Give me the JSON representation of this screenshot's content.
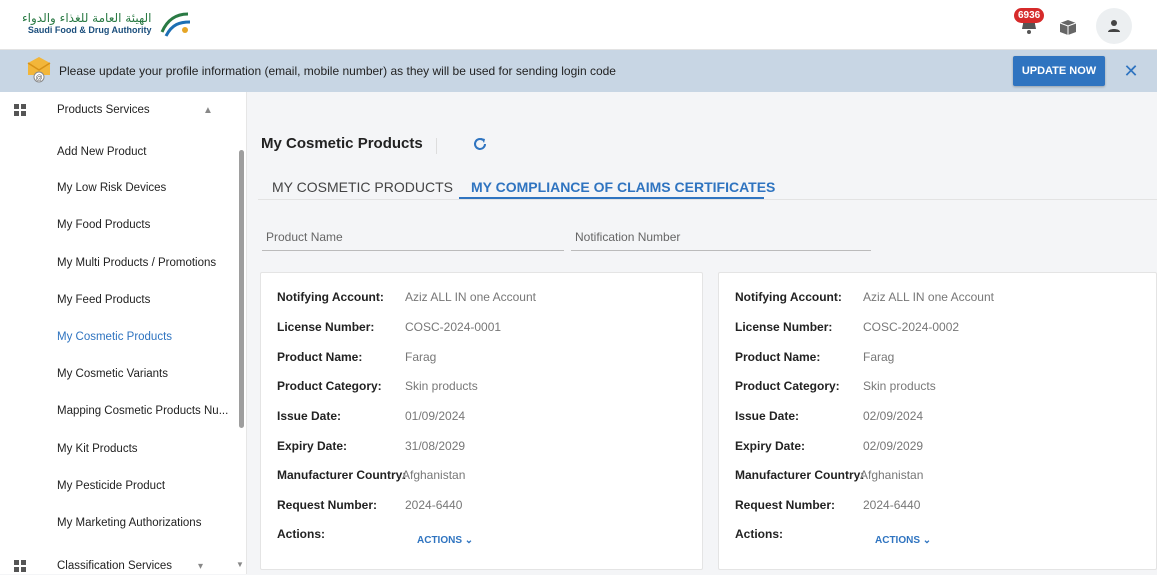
{
  "header": {
    "logo_ar": "الهيئة العامة للغذاء والدواء",
    "logo_en": "Saudi Food & Drug Authority",
    "notification_count": "6936"
  },
  "banner": {
    "message": "Please update your profile information (email, mobile number) as they will be used for sending login code",
    "button": "UPDATE NOW"
  },
  "sidebar": {
    "section_products": "Products Services",
    "items": [
      "Add New Product",
      "My Low Risk Devices",
      "My Food Products",
      "My Multi Products / Promotions",
      "My Feed Products",
      "My Cosmetic Products",
      "My Cosmetic Variants",
      "Mapping Cosmetic Products Nu...",
      "My Kit Products",
      "My Pesticide Product",
      "My Marketing Authorizations"
    ],
    "active_index": 5,
    "section_classification": "Classification Services"
  },
  "main": {
    "title": "My Cosmetic Products",
    "tabs": [
      "MY COSMETIC PRODUCTS",
      "MY COMPLIANCE OF CLAIMS CERTIFICATES"
    ],
    "active_tab": 1,
    "filters": {
      "product_name": "Product Name",
      "notification_number": "Notification Number"
    },
    "labels": {
      "notifying_account": "Notifying Account:",
      "license_number": "License Number:",
      "product_name": "Product Name:",
      "product_category": "Product Category:",
      "issue_date": "Issue Date:",
      "expiry_date": "Expiry Date:",
      "manufacturer_country": "Manufacturer Country:",
      "request_number": "Request Number:",
      "actions": "Actions:"
    },
    "actions_button": "ACTIONS ⌄",
    "cards": [
      {
        "notifying_account": "Aziz ALL IN one Account",
        "license_number": "COSC-2024-0001",
        "product_name": "Farag",
        "product_category": "Skin products",
        "issue_date": "01/09/2024",
        "expiry_date": "31/08/2029",
        "manufacturer_country": "Afghanistan",
        "request_number": "2024-6440"
      },
      {
        "notifying_account": "Aziz ALL IN one Account",
        "license_number": "COSC-2024-0002",
        "product_name": "Farag",
        "product_category": "Skin products",
        "issue_date": "02/09/2024",
        "expiry_date": "02/09/2029",
        "manufacturer_country": "Afghanistan",
        "request_number": "2024-6440"
      }
    ]
  },
  "colors": {
    "accent": "#2f74c0",
    "banner": "#c8d6e4",
    "badge": "#d62a2a"
  },
  "icons": {
    "logo": "sfda-logo-icon",
    "notification": "bell-icon",
    "box": "package-icon",
    "avatar": "user-icon",
    "banner": "email-at-icon",
    "refresh": "refresh-icon",
    "close": "close-icon",
    "section": "grid-icon"
  }
}
